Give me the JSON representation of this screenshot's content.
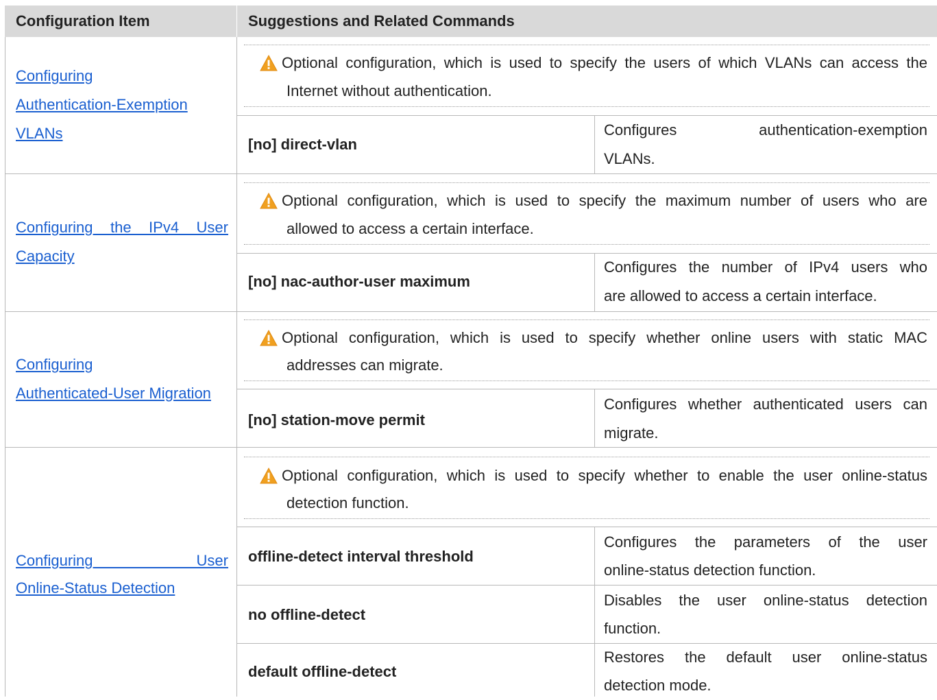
{
  "header": {
    "col1": "Configuration Item",
    "col2": "Suggestions and Related Commands"
  },
  "rows": [
    {
      "item_lines": [
        "Configuring ",
        "Authentication-Exemption ",
        "VLANs"
      ],
      "note_line1": "Optional configuration, which is used to specify the users of which VLANs can access the",
      "note_line2": "Internet without authentication.",
      "commands": [
        {
          "cmd": "[no] direct-vlan",
          "desc_line1": "Configures authentication-exemption",
          "desc_line2": "VLANs."
        }
      ]
    },
    {
      "item_lines": [
        "Configuring the IPv4 User",
        "Capacity"
      ],
      "note_line1": "Optional configuration, which is used to specify the maximum number of users who are",
      "note_line2": "allowed to access a certain interface.",
      "commands": [
        {
          "cmd": "[no] nac-author-user maximum",
          "desc_line1": "Configures the number of IPv4 users who",
          "desc_line2": "are allowed to access a certain interface."
        }
      ]
    },
    {
      "item_lines": [
        "Configuring ",
        "Authenticated-User Migration"
      ],
      "note_line1": "Optional configuration, which is used to specify whether online users with static MAC",
      "note_line2": "addresses can migrate.",
      "commands": [
        {
          "cmd": "[no] station-move permit",
          "desc_line1": "Configures whether authenticated users can",
          "desc_line2": "migrate."
        }
      ]
    },
    {
      "item_lines": [
        "Configuring User",
        "Online-Status Detection"
      ],
      "note_line1": "Optional configuration, which is used to specify whether to enable the user online-status",
      "note_line2": "detection function.",
      "commands": [
        {
          "cmd": "offline-detect interval threshold",
          "desc_line1": "Configures the parameters of the user",
          "desc_line2": "online-status detection function."
        },
        {
          "cmd": "no offline-detect",
          "desc_line1": "Disables the user online-status detection",
          "desc_line2": "function."
        },
        {
          "cmd": "default offline-detect",
          "desc_line1": "Restores the default user online-status",
          "desc_line2": "detection mode."
        }
      ]
    }
  ],
  "colors": {
    "header_bg": "#d9d9d9",
    "link": "#1a5fd0",
    "warning": "#f0a020"
  },
  "icons": {
    "note": "warning-triangle-icon"
  }
}
